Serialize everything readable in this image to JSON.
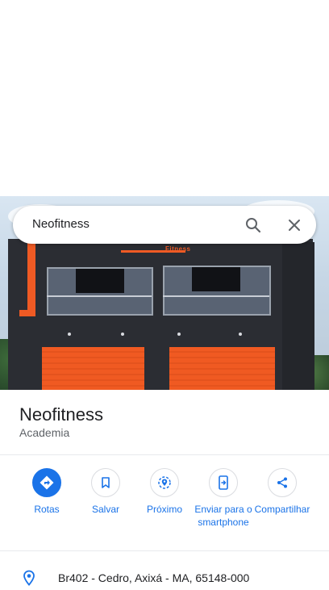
{
  "search": {
    "query": "Neofitness"
  },
  "photo": {
    "sign_text": "Fitness"
  },
  "place": {
    "name": "Neofitness",
    "category": "Academia"
  },
  "actions": [
    {
      "label": "Rotas",
      "icon": "directions-icon"
    },
    {
      "label": "Salvar",
      "icon": "bookmark-icon"
    },
    {
      "label": "Próximo",
      "icon": "nearby-icon"
    },
    {
      "label": "Enviar para o smartphone",
      "icon": "send-to-phone-icon"
    },
    {
      "label": "Compartilhar",
      "icon": "share-icon"
    }
  ],
  "address": {
    "text": "Br402 - Cedro, Axixá - MA, 65148-000",
    "icon": "location-pin-icon"
  },
  "colors": {
    "accent": "#1a73e8",
    "text": "#202124",
    "secondary": "#5f6368",
    "divider": "#e8eaed"
  }
}
